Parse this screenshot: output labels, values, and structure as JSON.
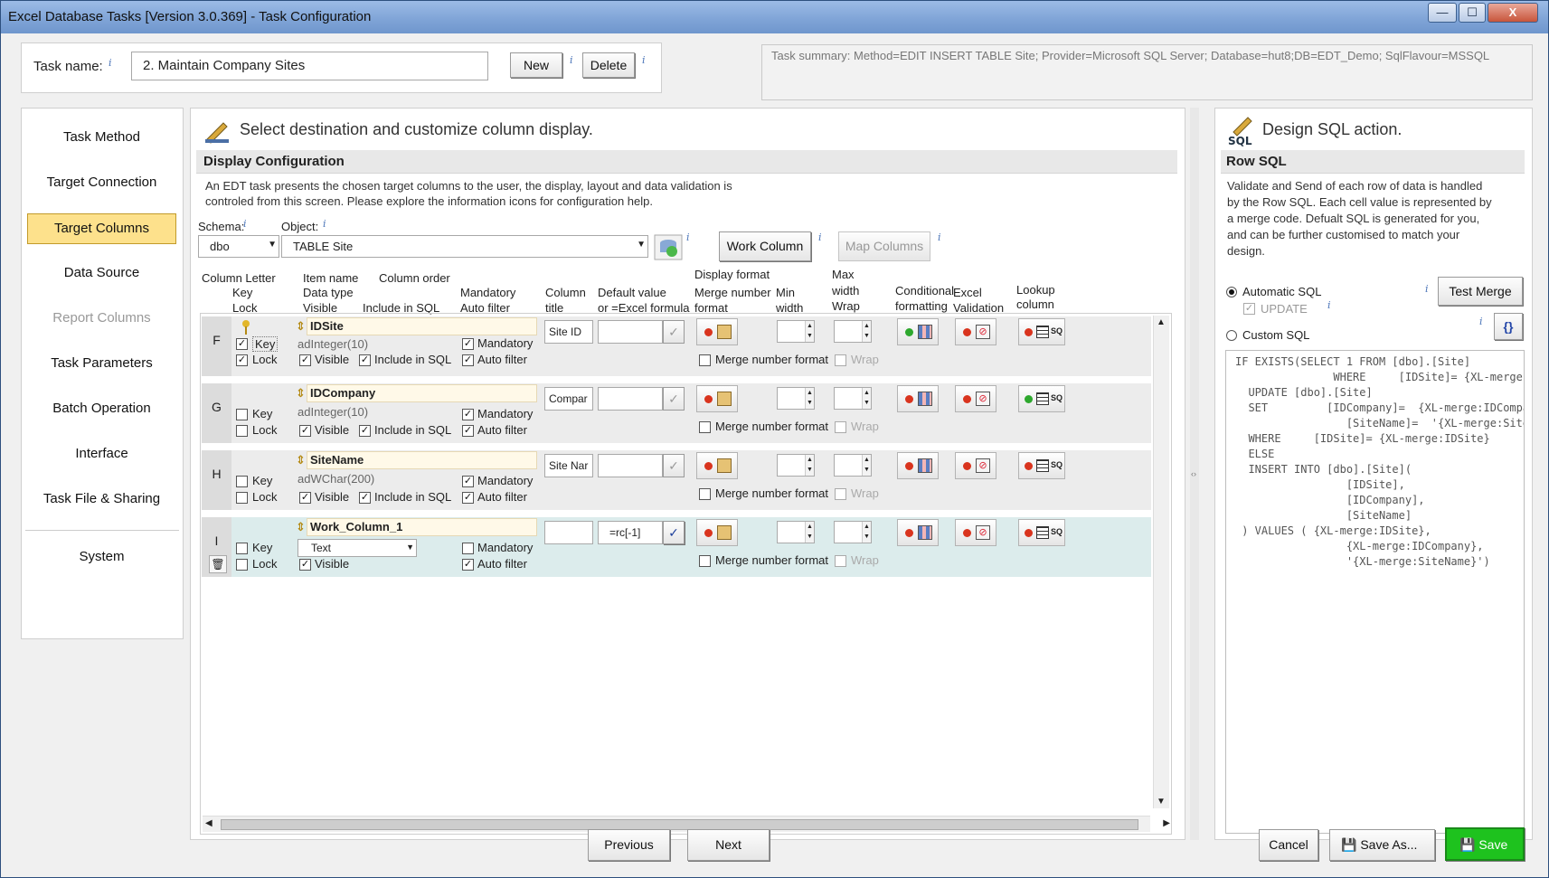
{
  "window": {
    "title": "Excel Database Tasks [Version 3.0.369] - Task Configuration",
    "min_label": "—",
    "max_label": "☐",
    "close_label": "X"
  },
  "header": {
    "task_name_label": "Task name:",
    "task_name_value": "2. Maintain Company Sites",
    "new_label": "New",
    "delete_label": "Delete",
    "summary": "Task summary: Method=EDIT INSERT TABLE Site; Provider=Microsoft SQL Server; Database=hut8;DB=EDT_Demo; SqlFlavour=MSSQL"
  },
  "nav": {
    "items": [
      "Task Method",
      "Target Connection",
      "Target Columns",
      "Data Source",
      "Report Columns",
      "Task Parameters",
      "Batch Operation",
      "Interface",
      "Task File & Sharing",
      "System"
    ]
  },
  "center": {
    "heading": "Select destination and customize column display.",
    "section": "Display Configuration",
    "desc1": "An EDT task presents the chosen target columns to the user, the display, layout and data validation is",
    "desc2": "controled from this screen.  Please explore the information icons for configuration help.",
    "schema_label": "Schema:",
    "schema_value": "dbo",
    "object_label": "Object:",
    "object_value": "TABLE Site",
    "work_column_label": "Work Column",
    "map_columns_label": "Map Columns",
    "headers": {
      "col_letter": "Column Letter",
      "key": "Key",
      "lock": "Lock",
      "item_name": "Item name",
      "column_order": "Column order",
      "data_type": "Data type",
      "visible": "Visible",
      "include_sql": "Include in SQL",
      "mandatory": "Mandatory",
      "auto_filter": "Auto filter",
      "col_title1": "Column",
      "col_title2": "title",
      "default1": "Default value",
      "default2": "or =Excel formula",
      "display_format": "Display format",
      "merge1": "Merge number",
      "merge2": "format",
      "min1": "Min",
      "min2": "width",
      "max1": "Max",
      "max2": "width",
      "wrap": "Wrap",
      "cond1": "Conditional",
      "cond2": "formatting",
      "excel1": "Excel",
      "excel2": "Validation",
      "lookup1": "Lookup",
      "lookup2": "column"
    },
    "row_labels": {
      "key": "Key",
      "lock": "Lock",
      "visible": "Visible",
      "include_sql": "Include in SQL",
      "mandatory": "Mandatory",
      "auto_filter": "Auto filter",
      "merge": "Merge number format",
      "wrap": "Wrap"
    },
    "rows": [
      {
        "letter": "F",
        "name": "IDSite",
        "type": "adInteger(10)",
        "title": "Site ID",
        "default": ""
      },
      {
        "letter": "G",
        "name": "IDCompany",
        "type": "adInteger(10)",
        "title": "Compar",
        "default": ""
      },
      {
        "letter": "H",
        "name": "SiteName",
        "type": "adWChar(200)",
        "title": "Site Nar",
        "default": ""
      },
      {
        "letter": "I",
        "name": "Work_Column_1",
        "type": "Text",
        "title": "",
        "default": "=rc[-1]"
      }
    ]
  },
  "right": {
    "heading": "Design SQL action.",
    "section": "Row SQL",
    "desc": [
      "Validate and Send of each row of data is handled",
      "by the Row SQL.  Each cell value is represented by",
      "a merge code. Defualt SQL is generated for you,",
      "and can be further customised to match your",
      "design."
    ],
    "auto_sql": "Automatic SQL",
    "update": "UPDATE",
    "custom_sql": "Custom SQL",
    "test_merge": "Test Merge",
    "braces": "{}",
    "sql": [
      "IF EXISTS(SELECT 1 FROM [dbo].[Site]",
      "               WHERE     [IDSite]= {XL-merge:IDSite} )",
      "  UPDATE [dbo].[Site]",
      "  SET         [IDCompany]=  {XL-merge:IDCompany},",
      "                 [SiteName]=  '{XL-merge:SiteName}'",
      "  WHERE     [IDSite]= {XL-merge:IDSite}",
      "  ELSE",
      "  INSERT INTO [dbo].[Site](",
      "                 [IDSite],",
      "                 [IDCompany],",
      "                 [SiteName]",
      " ) VALUES ( {XL-merge:IDSite},",
      "                 {XL-merge:IDCompany},",
      "                 '{XL-merge:SiteName}')"
    ]
  },
  "footer": {
    "previous": "Previous",
    "next": "Next",
    "cancel": "Cancel",
    "save_as": "Save As...",
    "save": "Save"
  },
  "icons": {
    "info": "i",
    "key": "key-icon",
    "sql": "sql-icon",
    "refresh": "refresh-icon"
  },
  "colors": {
    "selected_nav": "#fde18c",
    "save_button": "#1ec21e",
    "title_bar": "#7ea3d6"
  }
}
